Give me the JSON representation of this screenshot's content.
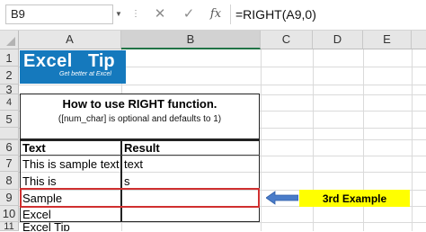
{
  "formula_bar": {
    "name_box": "B9",
    "cancel_icon": "x-icon",
    "enter_icon": "check-icon",
    "fx_label": "fx",
    "formula": "=RIGHT(A9,0)"
  },
  "columns": [
    "A",
    "B",
    "C",
    "D",
    "E"
  ],
  "rows": [
    "1",
    "2",
    "3",
    "4",
    "5",
    "6",
    "7",
    "8",
    "9",
    "10",
    "11"
  ],
  "logo": {
    "brand_left": "Excel",
    "brand_right": "Tip",
    "tagline": "Get better at Excel"
  },
  "table": {
    "title": "How to use RIGHT function.",
    "subtitle": "([num_char] is optional and defaults to 1)",
    "header_text": "Text",
    "header_result": "Result",
    "rows": [
      {
        "text": "This is sample text",
        "result": "text"
      },
      {
        "text": "This is",
        "result": "s"
      },
      {
        "text": "Sample",
        "result": ""
      },
      {
        "text": "Excel",
        "result": ""
      },
      {
        "text": "Excel Tip",
        "result": ""
      }
    ]
  },
  "callout": {
    "label": "3rd Example",
    "bg_color": "#ffff00",
    "arrow_color": "#4a7cc9"
  },
  "colors": {
    "logo_blue": "#1579bd",
    "highlight_red": "#d03030"
  }
}
